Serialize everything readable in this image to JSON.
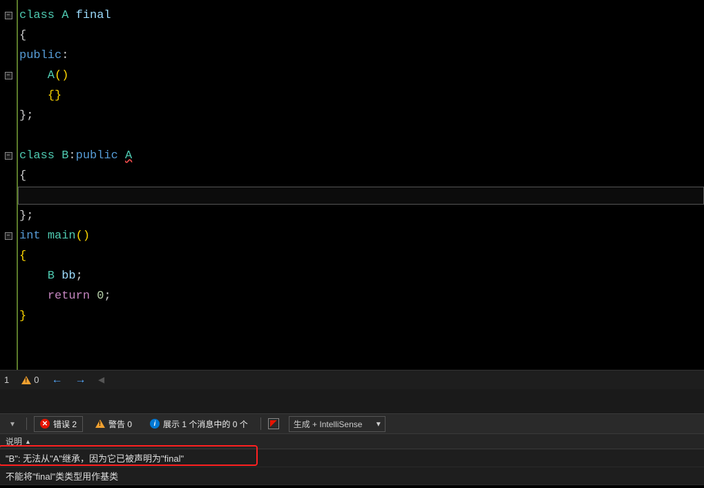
{
  "code": {
    "lines": [
      {
        "segments": [
          {
            "t": "class ",
            "c": "kw-class"
          },
          {
            "t": "A ",
            "c": "id-A"
          },
          {
            "t": "final",
            "c": "id-final"
          }
        ],
        "fold": "minus"
      },
      {
        "segments": [
          {
            "t": "{",
            "c": "punct"
          }
        ]
      },
      {
        "segments": [
          {
            "t": "public",
            "c": "kw-public"
          },
          {
            "t": ":",
            "c": "punct"
          }
        ]
      },
      {
        "segments": [
          {
            "t": "    A",
            "c": "id-A"
          },
          {
            "t": "()",
            "c": "brace"
          }
        ],
        "fold": "minus"
      },
      {
        "segments": [
          {
            "t": "    {}",
            "c": "brace"
          }
        ]
      },
      {
        "segments": [
          {
            "t": "};",
            "c": "punct"
          }
        ]
      },
      {
        "segments": [
          {
            "t": "",
            "c": ""
          }
        ]
      },
      {
        "segments": [
          {
            "t": "class ",
            "c": "kw-class"
          },
          {
            "t": "B",
            "c": "id-B"
          },
          {
            "t": ":",
            "c": "punct"
          },
          {
            "t": "public ",
            "c": "kw-public"
          },
          {
            "t": "A",
            "c": "id-A squiggle"
          }
        ],
        "fold": "minus"
      },
      {
        "segments": [
          {
            "t": "{",
            "c": "punct"
          }
        ]
      },
      {
        "segments": [
          {
            "t": "",
            "c": ""
          }
        ]
      },
      {
        "segments": [
          {
            "t": "};",
            "c": "punct"
          }
        ]
      },
      {
        "segments": [
          {
            "t": "int ",
            "c": "id-int"
          },
          {
            "t": "main",
            "c": "kw-type"
          },
          {
            "t": "()",
            "c": "brace"
          }
        ],
        "fold": "minus"
      },
      {
        "segments": [
          {
            "t": "{",
            "c": "brace"
          }
        ]
      },
      {
        "segments": [
          {
            "t": "    B ",
            "c": "id-B"
          },
          {
            "t": "bb",
            "c": "id-bb"
          },
          {
            "t": ";",
            "c": "punct"
          }
        ]
      },
      {
        "segments": [
          {
            "t": "    ",
            "c": ""
          },
          {
            "t": "return ",
            "c": "kw-return"
          },
          {
            "t": "0",
            "c": "num"
          },
          {
            "t": ";",
            "c": "punct"
          }
        ]
      },
      {
        "segments": [
          {
            "t": "}",
            "c": "brace"
          }
        ]
      }
    ]
  },
  "status": {
    "errors_label": "1",
    "warnings_label": "0"
  },
  "toolbar": {
    "errors_btn": "错误 2",
    "warnings_btn": "警告 0",
    "messages_btn": "展示 1 个消息中的 0 个",
    "build_select": "生成 + IntelliSense"
  },
  "error_list": {
    "header_desc": "说明",
    "rows": [
      "\"B\": 无法从\"A\"继承，因为它已被声明为\"final\"",
      "不能将\"final\"类类型用作基类"
    ]
  }
}
